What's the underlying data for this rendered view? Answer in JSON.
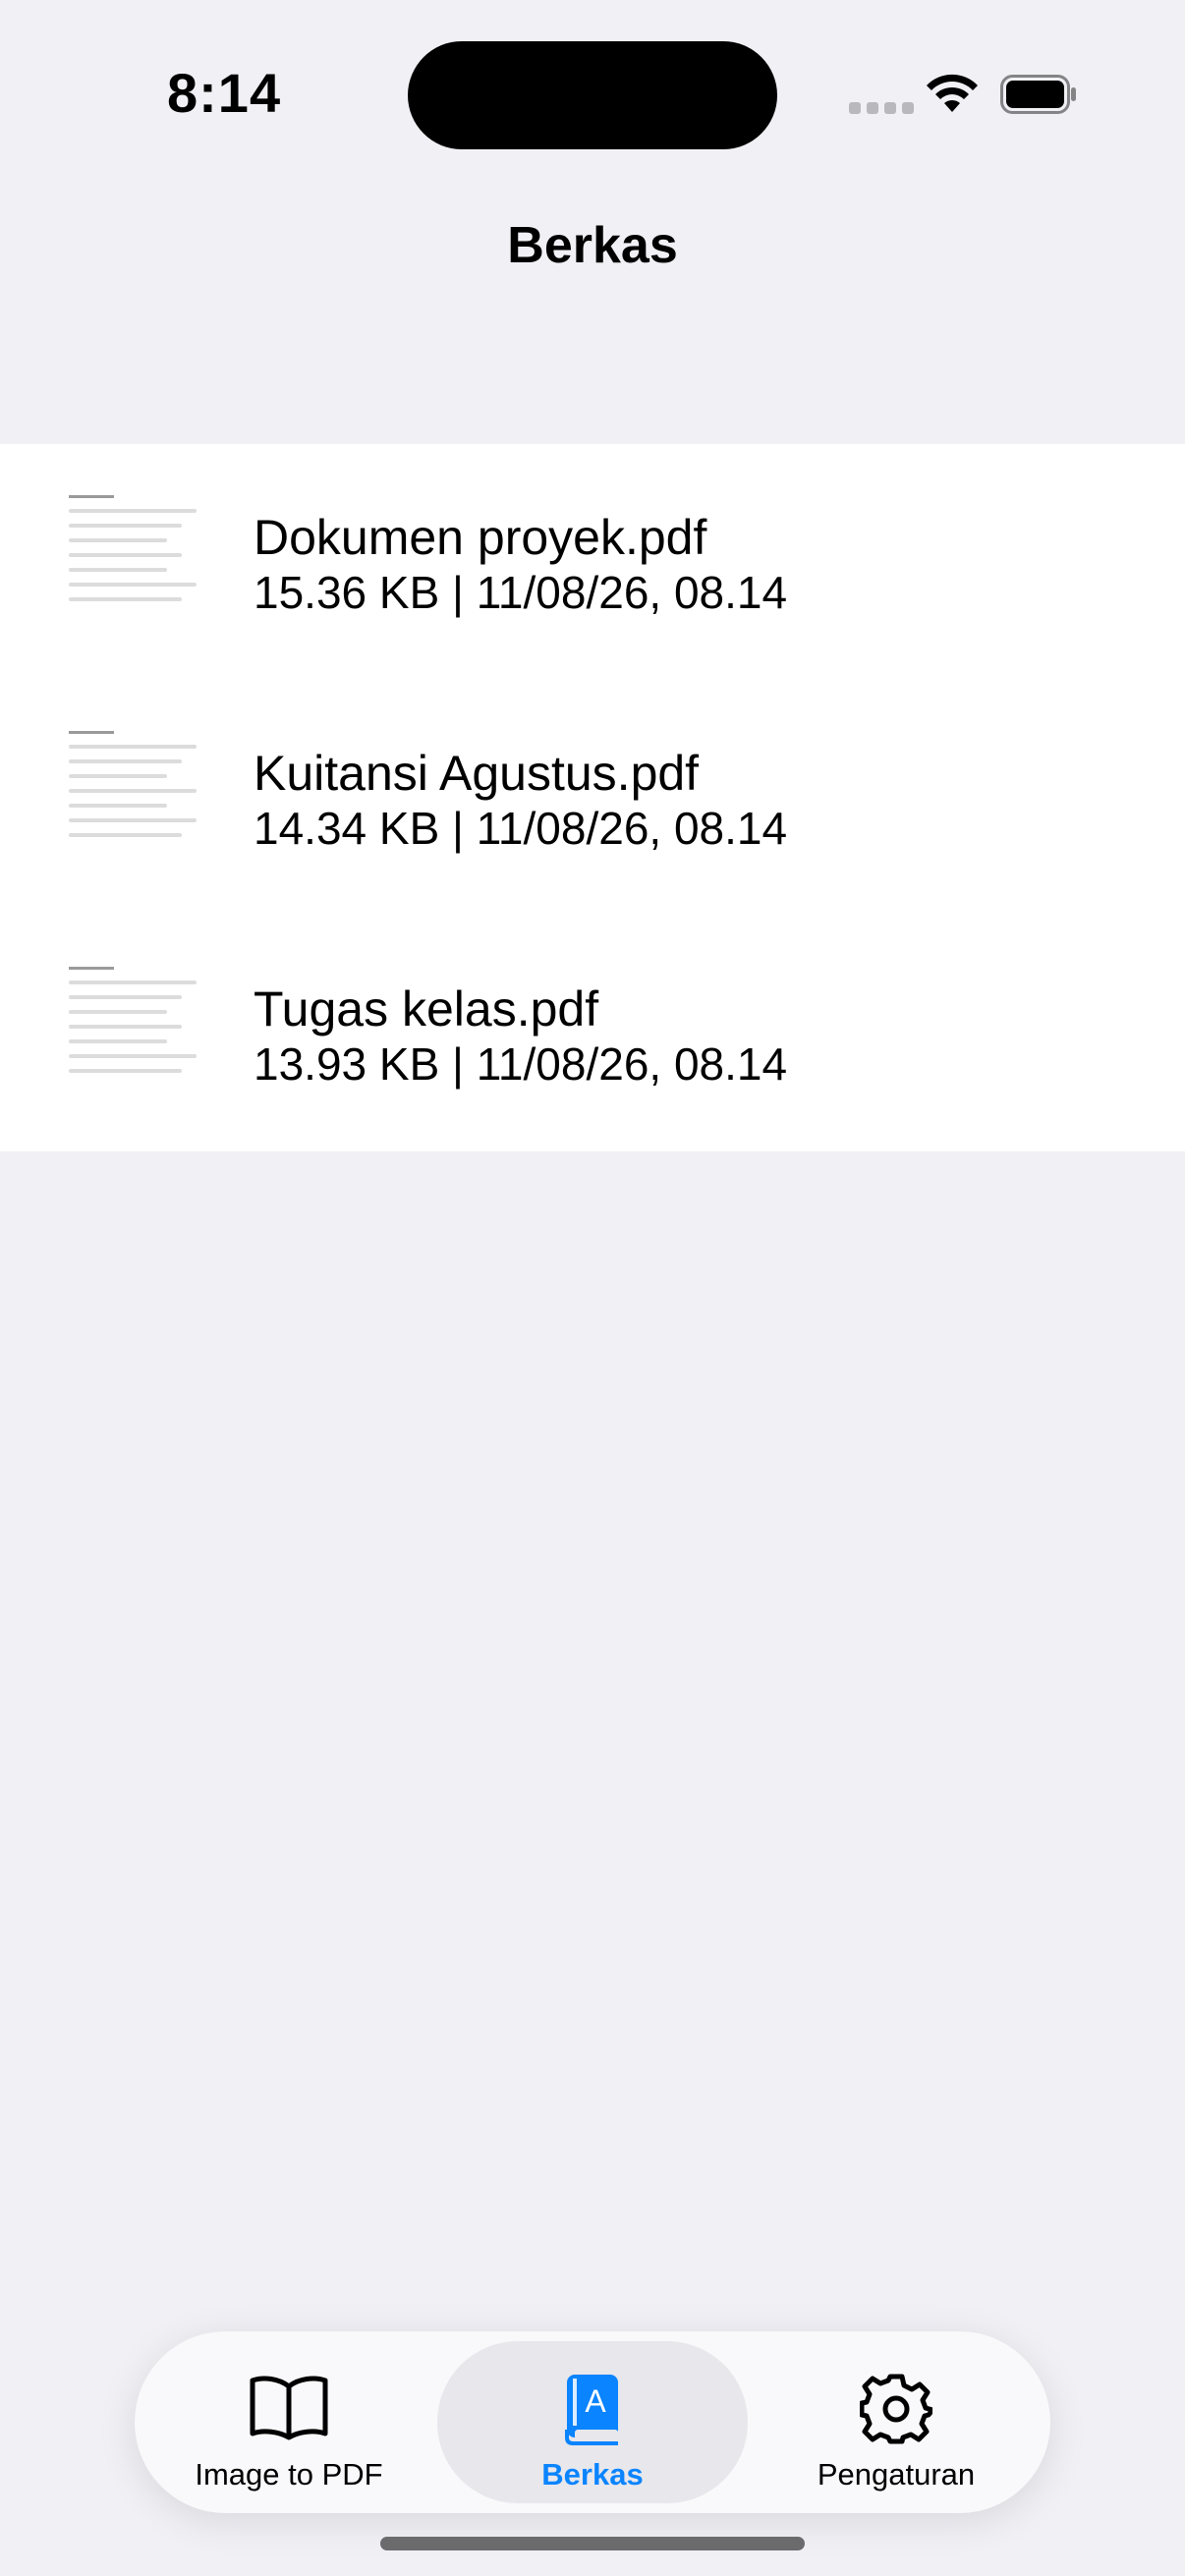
{
  "status_bar": {
    "time": "8:14"
  },
  "nav": {
    "title": "Berkas"
  },
  "files": [
    {
      "name": "Dokumen proyek.pdf",
      "meta": "15.36 KB | 11/08/26, 08.14"
    },
    {
      "name": "Kuitansi Agustus.pdf",
      "meta": "14.34 KB | 11/08/26, 08.14"
    },
    {
      "name": "Tugas kelas.pdf",
      "meta": "13.93 KB | 11/08/26, 08.14"
    }
  ],
  "tab_bar": {
    "tabs": [
      {
        "label": "Image to PDF",
        "icon": "book-open-icon",
        "selected": false
      },
      {
        "label": "Berkas",
        "icon": "book-fill-icon",
        "selected": true
      },
      {
        "label": "Pengaturan",
        "icon": "gear-icon",
        "selected": false
      }
    ]
  },
  "colors": {
    "accent": "#0a84ff",
    "background": "#f0f0f5",
    "list_background": "#ffffff"
  }
}
